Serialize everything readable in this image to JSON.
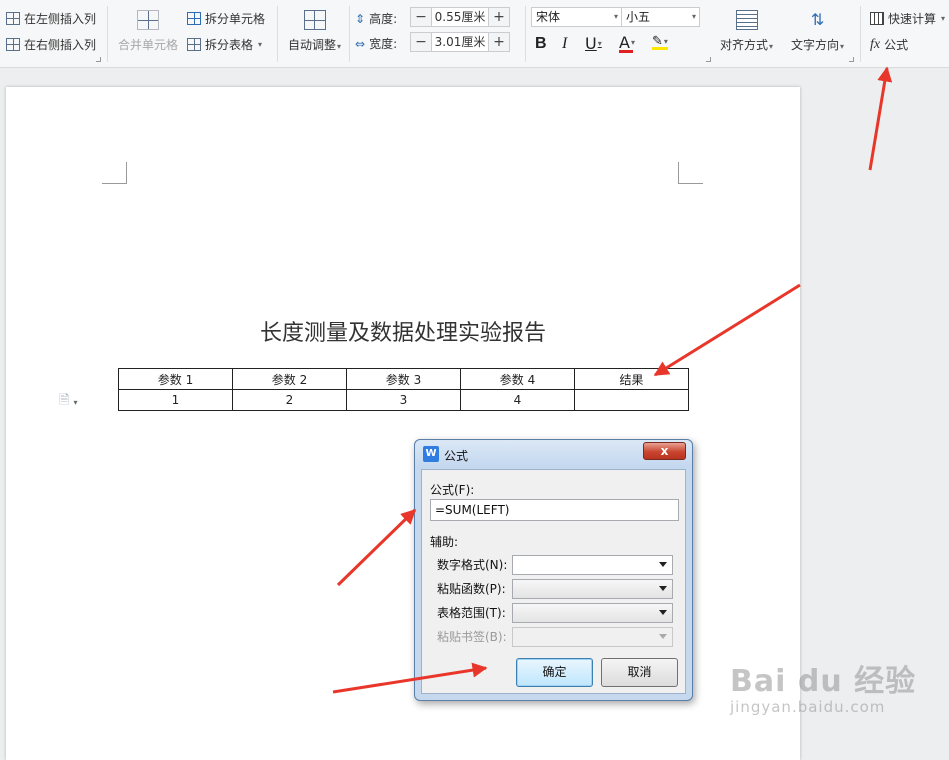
{
  "ribbon": {
    "insert_col_left": "在左侧插入列",
    "insert_col_right": "在右侧插入列",
    "merge_cells": "合并单元格",
    "split_cells": "拆分单元格",
    "split_table": "拆分表格",
    "auto_fit": "自动调整",
    "height_label": "高度:",
    "height_value": "0.55厘米",
    "width_label": "宽度:",
    "width_value": "3.01厘米",
    "font_name": "宋体",
    "font_size": "小五",
    "bold": "B",
    "italic": "I",
    "underline": "U",
    "font_color": "A",
    "align": "对齐方式",
    "text_direction": "文字方向",
    "quick_calc": "快速计算",
    "formula_icon": "fx",
    "formula": "公式"
  },
  "document": {
    "title": "长度测量及数据处理实验报告",
    "table": {
      "headers": [
        "参数 1",
        "参数 2",
        "参数 3",
        "参数 4",
        "结果"
      ],
      "rows": [
        [
          "1",
          "2",
          "3",
          "4",
          ""
        ]
      ]
    }
  },
  "dialog": {
    "title": "公式",
    "close": "x",
    "formula_label": "公式(F):",
    "formula_value": "=SUM(LEFT)",
    "aux_label": "辅助:",
    "number_format_label": "数字格式(N):",
    "paste_function_label": "粘贴函数(P):",
    "table_range_label": "表格范围(T):",
    "paste_bookmark_label": "粘贴书签(B):",
    "ok": "确定",
    "cancel": "取消"
  },
  "watermark": {
    "main": "Bai du 经验",
    "sub": "jingyan.baidu.com"
  },
  "colors": {
    "arrow": "#e8372a",
    "font_color_bar": "#e02020",
    "highlight_bar": "#ffe600"
  }
}
